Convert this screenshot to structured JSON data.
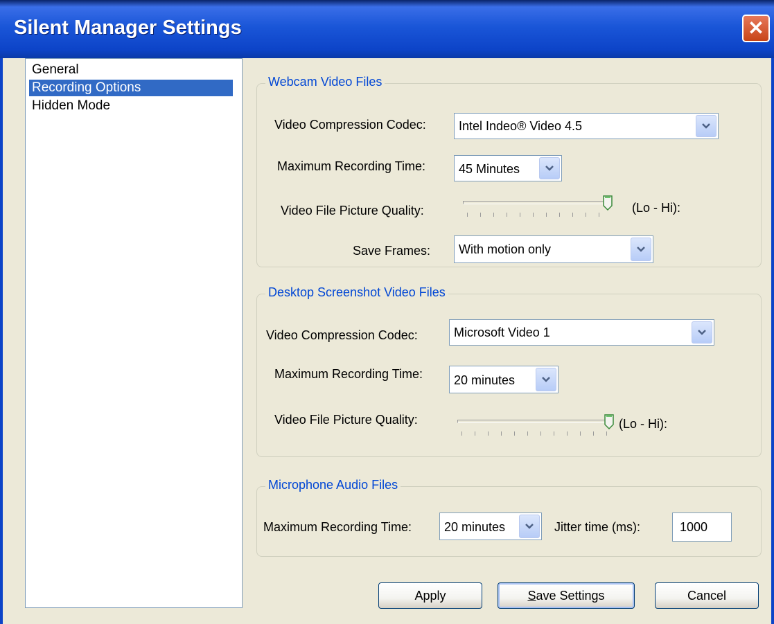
{
  "window": {
    "title": "Silent Manager Settings",
    "close_glyph": "✕"
  },
  "nav": {
    "items": [
      "General",
      "Recording Options",
      "Hidden Mode"
    ],
    "selected": 1
  },
  "webcam": {
    "legend": "Webcam Video Files",
    "codec_label": "Video Compression Codec:",
    "codec_value": "Intel Indeo® Video 4.5",
    "maxtime_label": "Maximum Recording Time:",
    "maxtime_value": "45 Minutes",
    "quality_label": "Video File Picture Quality:",
    "quality_range": "(Lo - Hi):",
    "quality_level": 1.0,
    "frames_label": "Save Frames:",
    "frames_value": "With motion only"
  },
  "desktop": {
    "legend": "Desktop Screenshot Video Files",
    "codec_label": "Video Compression Codec:",
    "codec_value": "Microsoft Video 1",
    "maxtime_label": "Maximum Recording Time:",
    "maxtime_value": "20 minutes",
    "quality_label": "Video File Picture Quality:",
    "quality_range": "(Lo - Hi):",
    "quality_level": 1.0
  },
  "audio": {
    "legend": "Microphone Audio Files",
    "maxtime_label": "Maximum Recording Time:",
    "maxtime_value": "20 minutes",
    "jitter_label": "Jitter time (ms):",
    "jitter_value": "1000"
  },
  "buttons": {
    "apply": "Apply",
    "save_first": "S",
    "save_rest": "ave Settings",
    "cancel": "Cancel"
  },
  "icons": {
    "dropdown": "chevron-down-icon",
    "close": "close-icon",
    "slider": "slider-thumb-icon"
  },
  "colors": {
    "title_bar": "#0d44c8",
    "selection": "#316ac5",
    "legend_text": "#0046d5",
    "close_button": "#d4542a"
  }
}
